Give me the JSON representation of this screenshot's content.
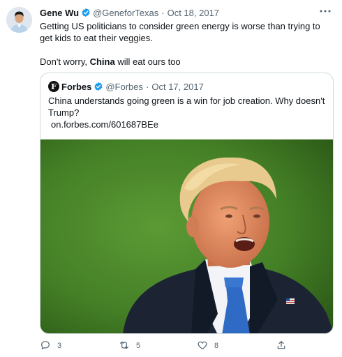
{
  "tweet": {
    "author_name": "Gene Wu",
    "handle": "@GeneforTexas",
    "separator": "·",
    "date": "Oct 18, 2017",
    "line1": "Getting US politicians to consider green energy is worse than trying to get kids to eat their veggies.",
    "line2_prefix": "Don't worry, ",
    "line2_bold": "China",
    "line2_suffix": " will eat ours too"
  },
  "quoted": {
    "avatar_letter": "F",
    "author_name": "Forbes",
    "handle": "@Forbes",
    "separator": "·",
    "date": "Oct 17, 2017",
    "text": "China understands going green is a win for job creation. Why doesn't Trump?",
    "link": "on.forbes.com/601687BEe"
  },
  "actions": {
    "reply_count": "3",
    "retweet_count": "5",
    "like_count": "8"
  },
  "icons": {
    "verified": "verified-badge-icon",
    "more": "more-options-icon",
    "reply": "reply-icon",
    "retweet": "retweet-icon",
    "like": "heart-icon",
    "share": "share-icon"
  },
  "colors": {
    "text": "#0f1419",
    "secondary": "#536471",
    "verified": "#1d9bf0",
    "border": "#cfd9de"
  }
}
